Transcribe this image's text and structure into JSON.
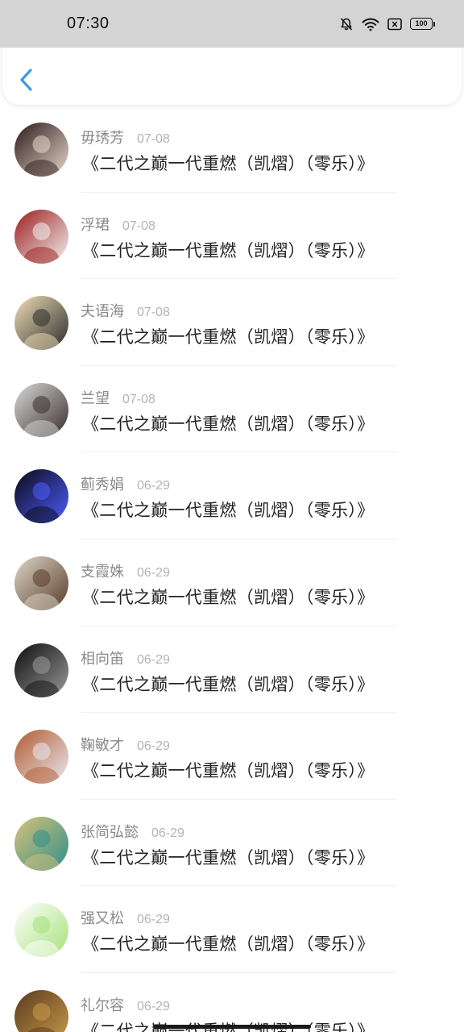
{
  "status_bar": {
    "time": "07:30",
    "battery": "100"
  },
  "items": [
    {
      "name": "毋琇芳",
      "date": "07-08",
      "title": "《二代之巅一代重燃（凯熠）（零乐）》",
      "avatar_colors": [
        "#2a1a18",
        "#e8d7cb"
      ]
    },
    {
      "name": "浮珺",
      "date": "07-08",
      "title": "《二代之巅一代重燃（凯熠）（零乐）》",
      "avatar_colors": [
        "#9c1c1c",
        "#f2f2f2"
      ]
    },
    {
      "name": "夫语海",
      "date": "07-08",
      "title": "《二代之巅一代重燃（凯熠）（零乐）》",
      "avatar_colors": [
        "#f1dfb6",
        "#2b2b2b"
      ]
    },
    {
      "name": "兰望",
      "date": "07-08",
      "title": "《二代之巅一代重燃（凯熠）（零乐）》",
      "avatar_colors": [
        "#d8d8d8",
        "#3a3030"
      ]
    },
    {
      "name": "蓟秀娟",
      "date": "06-29",
      "title": "《二代之巅一代重燃（凯熠）（零乐）》",
      "avatar_colors": [
        "#0a0a12",
        "#4d5cff"
      ]
    },
    {
      "name": "支霞姝",
      "date": "06-29",
      "title": "《二代之巅一代重燃（凯熠）（零乐）》",
      "avatar_colors": [
        "#dcd7c6",
        "#5a3b2a"
      ]
    },
    {
      "name": "相向笛",
      "date": "06-29",
      "title": "《二代之巅一代重燃（凯熠）（零乐）》",
      "avatar_colors": [
        "#0d0d0d",
        "#9a9a9a"
      ]
    },
    {
      "name": "鞠敏才",
      "date": "06-29",
      "title": "《二代之巅一代重燃（凯熠）（零乐）》",
      "avatar_colors": [
        "#b25a2e",
        "#e9e9f2"
      ]
    },
    {
      "name": "张简弘懿",
      "date": "06-29",
      "title": "《二代之巅一代重燃（凯熠）（零乐）》",
      "avatar_colors": [
        "#d9c27a",
        "#2d8f8a"
      ]
    },
    {
      "name": "强又松",
      "date": "06-29",
      "title": "《二代之巅一代重燃（凯熠）（零乐）》",
      "avatar_colors": [
        "#ffffff",
        "#a6e07a"
      ]
    },
    {
      "name": "礼尔容",
      "date": "06-29",
      "title": "《二代之巅一代重燃（凯熠）（零乐）》",
      "avatar_colors": [
        "#5a3a1e",
        "#c89a4a"
      ]
    }
  ]
}
